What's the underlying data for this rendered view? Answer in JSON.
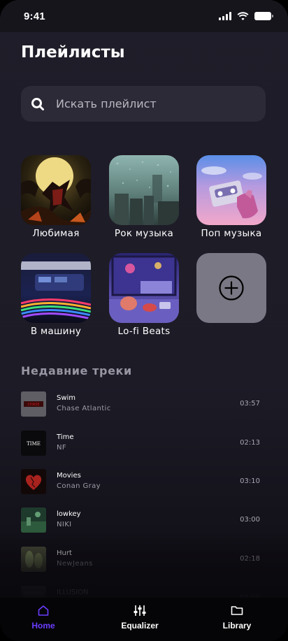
{
  "status_bar": {
    "time": "9:41"
  },
  "header": {
    "title": "Плейлисты"
  },
  "search": {
    "placeholder": "Искать плейлист",
    "value": ""
  },
  "playlists": [
    {
      "label": "Любимая",
      "cover": "moon-samurai-art"
    },
    {
      "label": "Рок музыка",
      "cover": "rainy-city-art"
    },
    {
      "label": "Поп музыка",
      "cover": "cassette-hand-art"
    },
    {
      "label": "В машину",
      "cover": "night-car-art"
    },
    {
      "label": "Lo-fi Beats",
      "cover": "lofi-window-art"
    }
  ],
  "add_playlist": {
    "icon": "plus-circle-icon"
  },
  "recent": {
    "title": "Недавние треки",
    "tracks": [
      {
        "title": "Swim",
        "artist": "Chase Atlantic",
        "duration": "03:57"
      },
      {
        "title": "Time",
        "artist": "NF",
        "duration": "02:13",
        "cover_text": "TIME"
      },
      {
        "title": "Movies",
        "artist": "Conan Gray",
        "duration": "03:10"
      },
      {
        "title": "lowkey",
        "artist": "NIKI",
        "duration": "03:00"
      },
      {
        "title": "Hurt",
        "artist": "NewJeans",
        "duration": "02:18"
      },
      {
        "title": "ILLUSION",
        "artist": "",
        "duration": "03:06"
      }
    ]
  },
  "tabbar": {
    "tabs": [
      {
        "label": "Home",
        "icon": "home-icon",
        "active": true
      },
      {
        "label": "Equalizer",
        "icon": "equalizer-icon",
        "active": false
      },
      {
        "label": "Library",
        "icon": "folder-icon",
        "active": false
      }
    ]
  },
  "colors": {
    "accent": "#6a3cff",
    "background": "#1f1d29",
    "search_bg": "#2c2a36",
    "add_tile": "#7a7884"
  }
}
